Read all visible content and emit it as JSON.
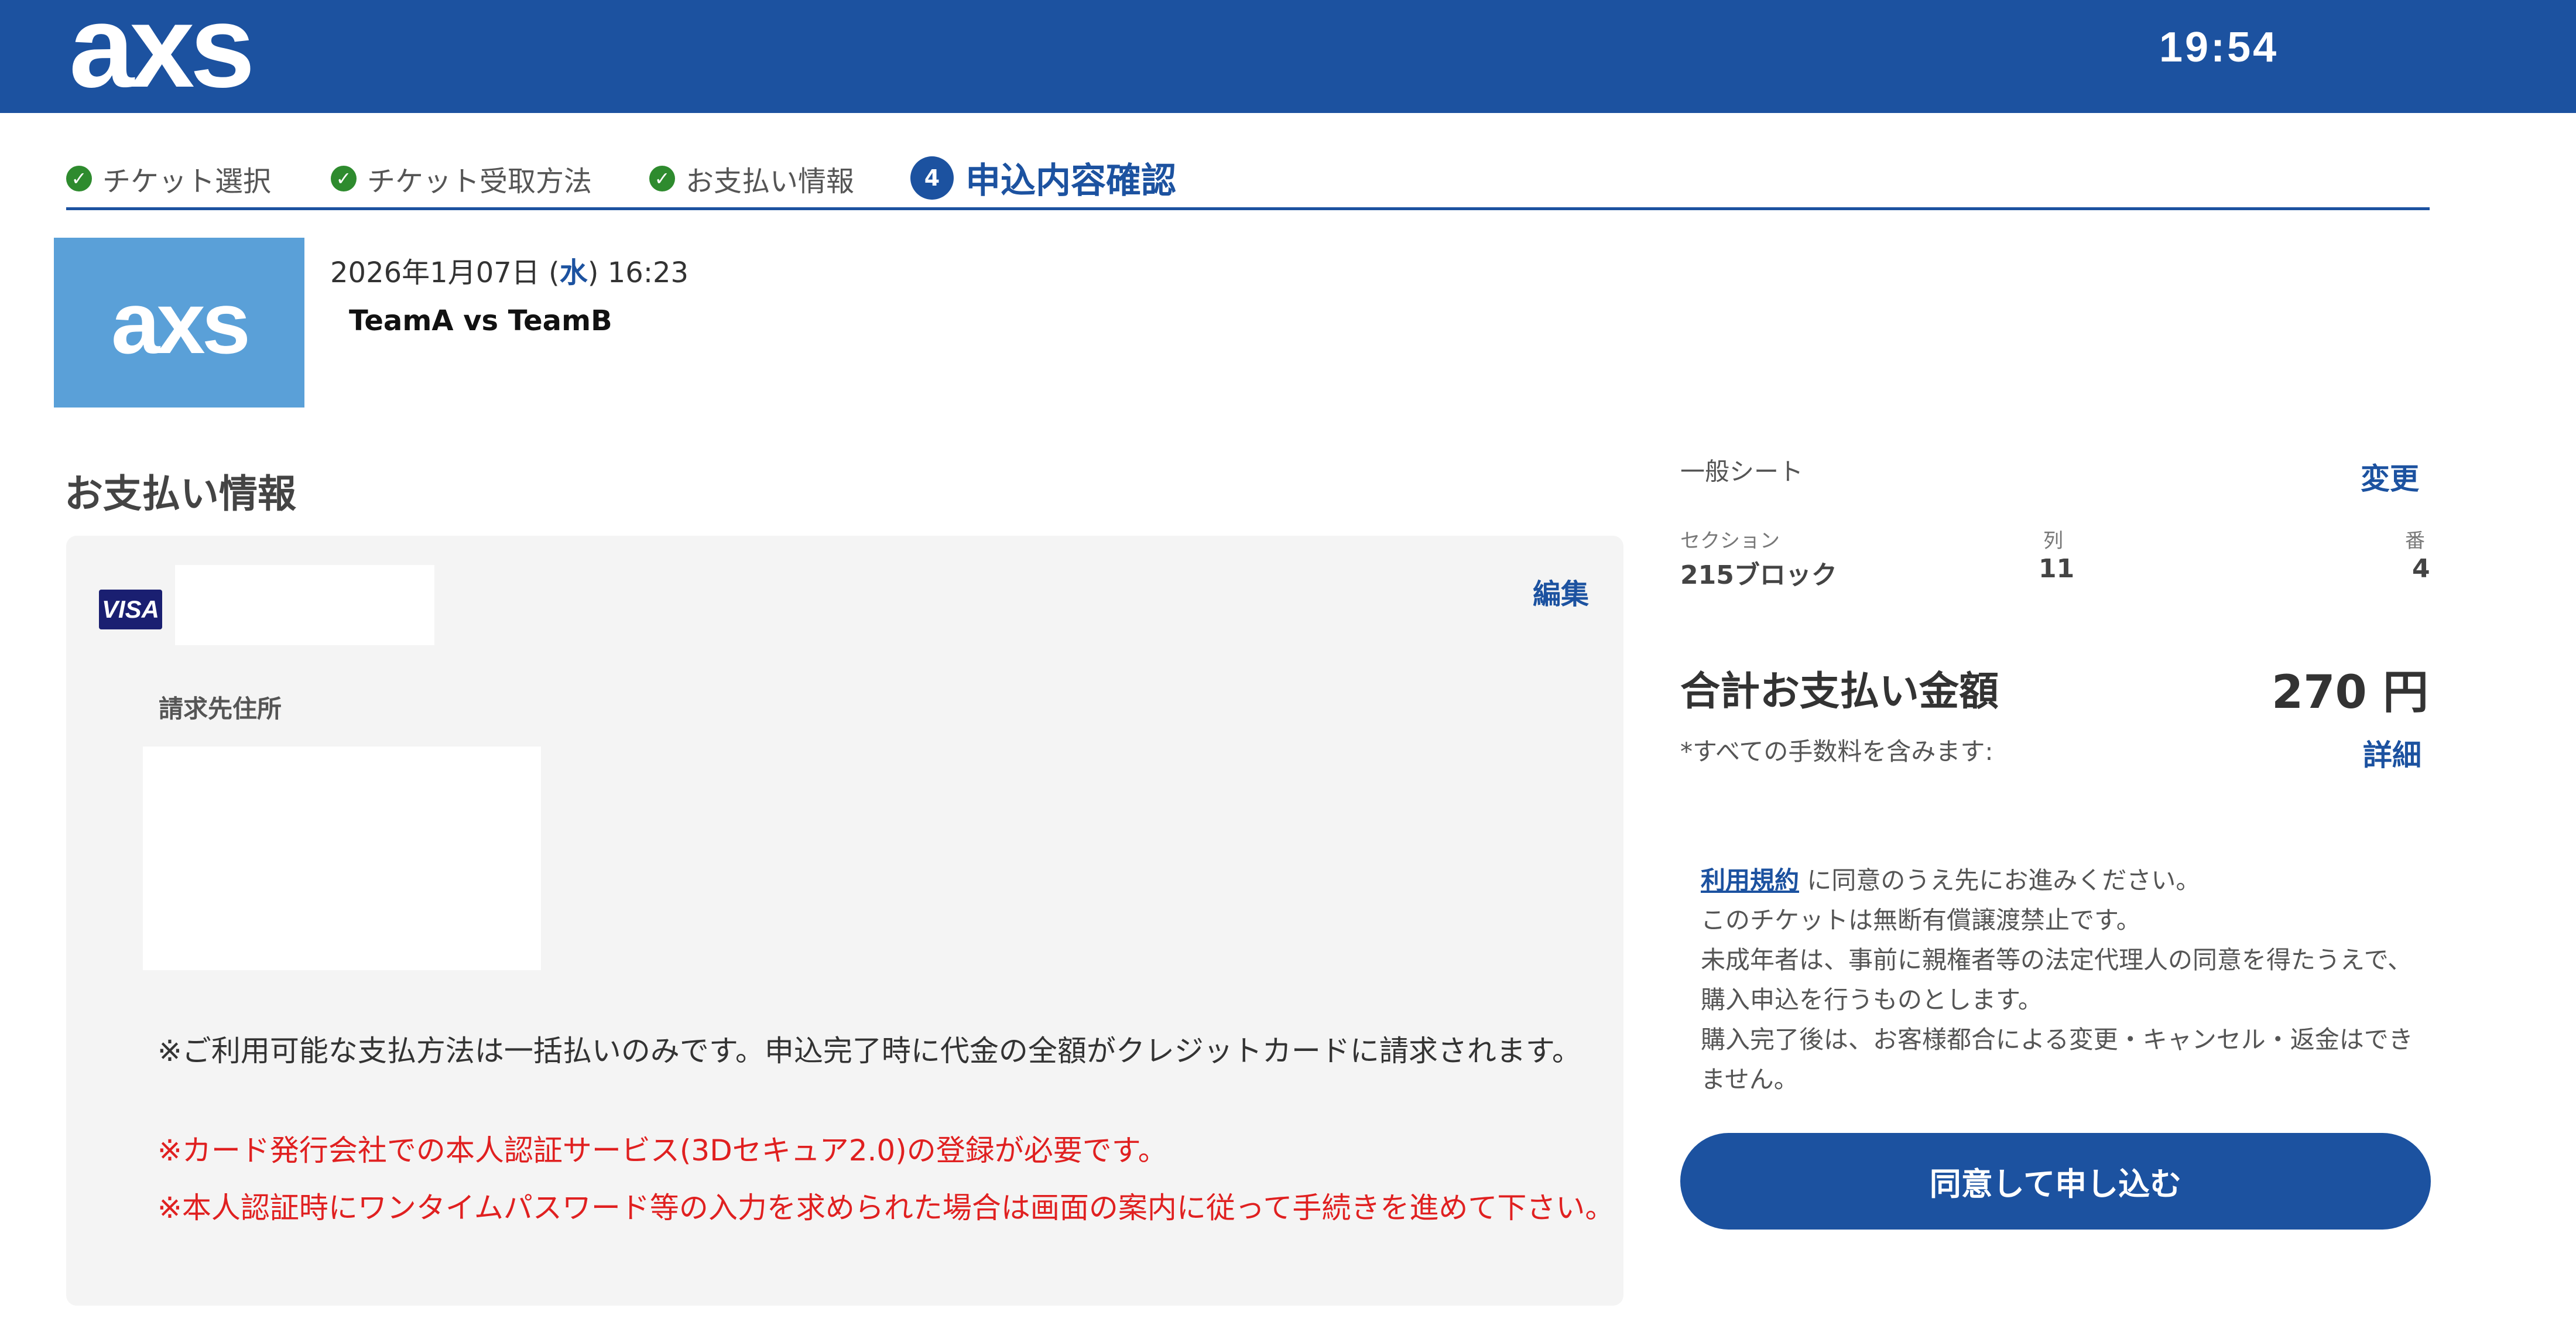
{
  "header": {
    "logo": "axs",
    "timer": "19:54"
  },
  "steps": [
    {
      "label": "チケット選択",
      "status": "done"
    },
    {
      "label": "チケット受取方法",
      "status": "done"
    },
    {
      "label": "お支払い情報",
      "status": "done"
    },
    {
      "number": "4",
      "label": "申込内容確認",
      "status": "active"
    }
  ],
  "event": {
    "logo": "axs",
    "date_prefix": "2026年1月07日 (",
    "day_of_week": "水",
    "date_suffix": ") 16:23",
    "title": "TeamA vs TeamB"
  },
  "payment": {
    "heading": "お支払い情報",
    "card_brand": "VISA",
    "edit_label": "編集",
    "billing_label": "請求先住所",
    "notes": [
      "※ご利用可能な支払方法は一括払いのみです。申込完了時に代金の全額がクレジットカードに請求されます。",
      "※カード発行会社での本人認証サービス(3Dセキュア2.0)の登録が必要です。",
      "※本人認証時にワンタイムパスワード等の入力を求められた場合は画面の案内に従って手続きを進めて下さい。"
    ]
  },
  "summary": {
    "seat_type": "一般シート",
    "change_label": "変更",
    "section_label": "セクション",
    "section_value": "215ブロック",
    "row_label": "列",
    "row_value": "11",
    "seat_label": "番",
    "seat_value": "4",
    "total_label": "合計お支払い金額",
    "total_amount": "270 円",
    "fee_note": "*すべての手数料を含みます:",
    "detail_label": "詳細",
    "terms_link": "利用規約",
    "terms_line1_rest": " に同意のうえ先にお進みください。",
    "terms_line2": "このチケットは無断有償譲渡禁止です。",
    "terms_line3": "未成年者は、事前に親権者等の法定代理人の同意を得たうえで、購入申込を行うものとします。",
    "terms_line4": "購入完了後は、お客様都合による変更・キャンセル・返金はできません。",
    "agree_button": "同意して申し込む"
  },
  "colors": {
    "brand": "#1c52a0",
    "check": "#2e8b2e",
    "warning": "#e02020",
    "panel": "#f4f4f4"
  }
}
